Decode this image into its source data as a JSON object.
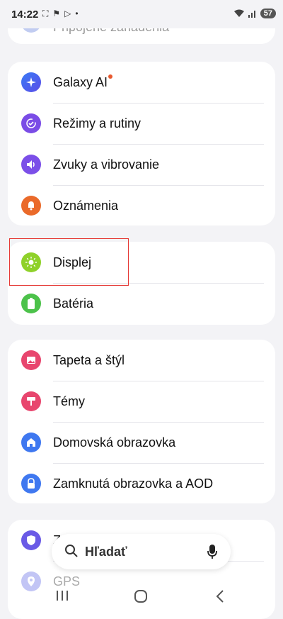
{
  "status_bar": {
    "time": "14:22",
    "battery": "57"
  },
  "top_partial_item": {
    "label": "Pripojené zariadenia"
  },
  "group1": [
    {
      "label": "Galaxy AI",
      "icon": "sparkle-icon",
      "color": "#3f6ff0",
      "new_badge": true
    },
    {
      "label": "Režimy a rutiny",
      "icon": "check-circle-icon",
      "color": "#7a4ce6"
    },
    {
      "label": "Zvuky a vibrovanie",
      "icon": "speaker-icon",
      "color": "#7b4fe8"
    },
    {
      "label": "Oznámenia",
      "icon": "bell-icon",
      "color": "#ea6a2a"
    }
  ],
  "group2": [
    {
      "label": "Displej",
      "icon": "sun-icon",
      "color": "#8fd12a"
    },
    {
      "label": "Batéria",
      "icon": "battery-icon",
      "color": "#4cc24a"
    }
  ],
  "group3": [
    {
      "label": "Tapeta a štýl",
      "icon": "image-icon",
      "color": "#e8466e"
    },
    {
      "label": "Témy",
      "icon": "paint-roller-icon",
      "color": "#e8466e"
    },
    {
      "label": "Domovská obrazovka",
      "icon": "home-icon",
      "color": "#3f78f0"
    },
    {
      "label": "Zamknutá obrazovka a AOD",
      "icon": "lock-icon",
      "color": "#3f78f0"
    }
  ],
  "group4_partial": [
    {
      "label": "Z",
      "icon": "shield-icon",
      "color": "#6a5ae6"
    },
    {
      "label": "GPS",
      "icon": "location-icon",
      "color": "#9aa0f0"
    }
  ],
  "search": {
    "label": "Hľadať"
  },
  "colors": {
    "highlight": "#e53935",
    "card": "#ffffff",
    "background": "#f3f3f6"
  }
}
